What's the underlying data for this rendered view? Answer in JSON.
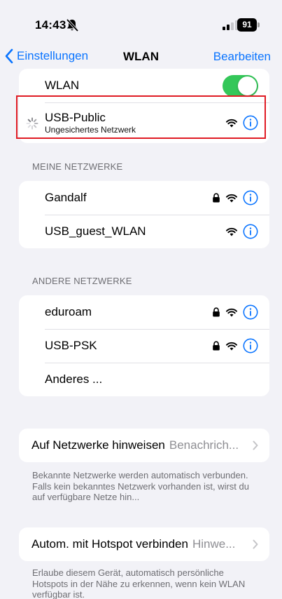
{
  "status_bar": {
    "time": "14:43",
    "battery": "91"
  },
  "nav": {
    "back_label": "Einstellungen",
    "title": "WLAN",
    "edit_label": "Bearbeiten"
  },
  "wlan": {
    "toggle_label": "WLAN",
    "toggle_on": true,
    "current_network": {
      "name": "USB-Public",
      "subtitle": "Ungesichertes Netzwerk"
    }
  },
  "my_networks": {
    "header": "MEINE NETZWERKE",
    "items": [
      {
        "name": "Gandalf",
        "locked": true
      },
      {
        "name": "USB_guest_WLAN",
        "locked": false
      }
    ]
  },
  "other_networks": {
    "header": "ANDERE NETZWERKE",
    "items": [
      {
        "name": "eduroam",
        "locked": true
      },
      {
        "name": "USB-PSK",
        "locked": true
      }
    ],
    "other_label": "Anderes ..."
  },
  "ask_to_join": {
    "label": "Auf Netzwerke hinweisen",
    "value": "Benachrich...",
    "footer": "Bekannte Netzwerke werden automatisch verbunden. Falls kein bekanntes Netzwerk vorhanden ist, wirst du auf verfügbare Netze hin..."
  },
  "hotspot": {
    "label": "Autom. mit Hotspot verbinden",
    "value": "Hinwe...",
    "footer": "Erlaube diesem Gerät, automatisch persönliche Hotspots in der Nähe zu erkennen, wenn kein WLAN verfügbar ist."
  },
  "colors": {
    "accent": "#0a74ff",
    "toggle_on": "#34c759",
    "highlight": "#e01b24",
    "background": "#f2f2f7"
  }
}
